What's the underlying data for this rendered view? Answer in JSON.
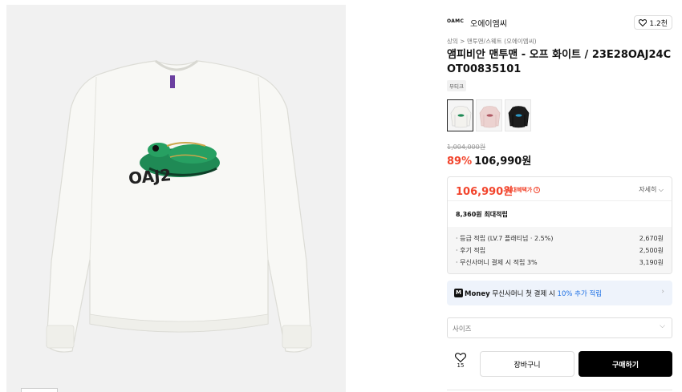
{
  "brand": {
    "logo": "OAMC",
    "name": "오에이엠씨",
    "likes": "1.2천"
  },
  "breadcrumb": "상의 > 맨투맨/스웨트 (오에이엠씨)",
  "product": {
    "title": "앰피비안 맨투맨 - 오프 화이트 / 23E28OAJ24COT00835101",
    "tag": "부티크"
  },
  "color_options": [
    {
      "name": "off-white",
      "color": "#f3f2ee",
      "selected": true
    },
    {
      "name": "pink",
      "color": "#ecd2d0",
      "selected": false
    },
    {
      "name": "black",
      "color": "#1c1c1c",
      "selected": false
    }
  ],
  "price": {
    "original": "1,004,000원",
    "discount": "89%",
    "sale": "106,990원"
  },
  "benefit": {
    "price": "106,990원",
    "max_label": "최대혜택가",
    "detail_label": "자세히",
    "points_line": "8,360원 최대적립",
    "points": [
      {
        "label": "· 등급 적립 (LV.7 플래티넘 · 2.5%)",
        "value": "2,670원"
      },
      {
        "label": "· 후기 적립",
        "value": "2,500원"
      },
      {
        "label": "· 무신사머니 결제 시 적립 3%",
        "value": "3,190원"
      }
    ]
  },
  "money_banner": {
    "icon": "M",
    "word": "Money",
    "text": " 무신사머니 첫 결제 시 ",
    "accent": "10% 추가 적립"
  },
  "size_select": {
    "placeholder": "사이즈"
  },
  "actions": {
    "wish_count": "15",
    "cart_label": "장바구니",
    "buy_label": "구매하기"
  },
  "colors": {
    "accent_red": "#f2442c",
    "accent_blue": "#1c6fe4"
  }
}
